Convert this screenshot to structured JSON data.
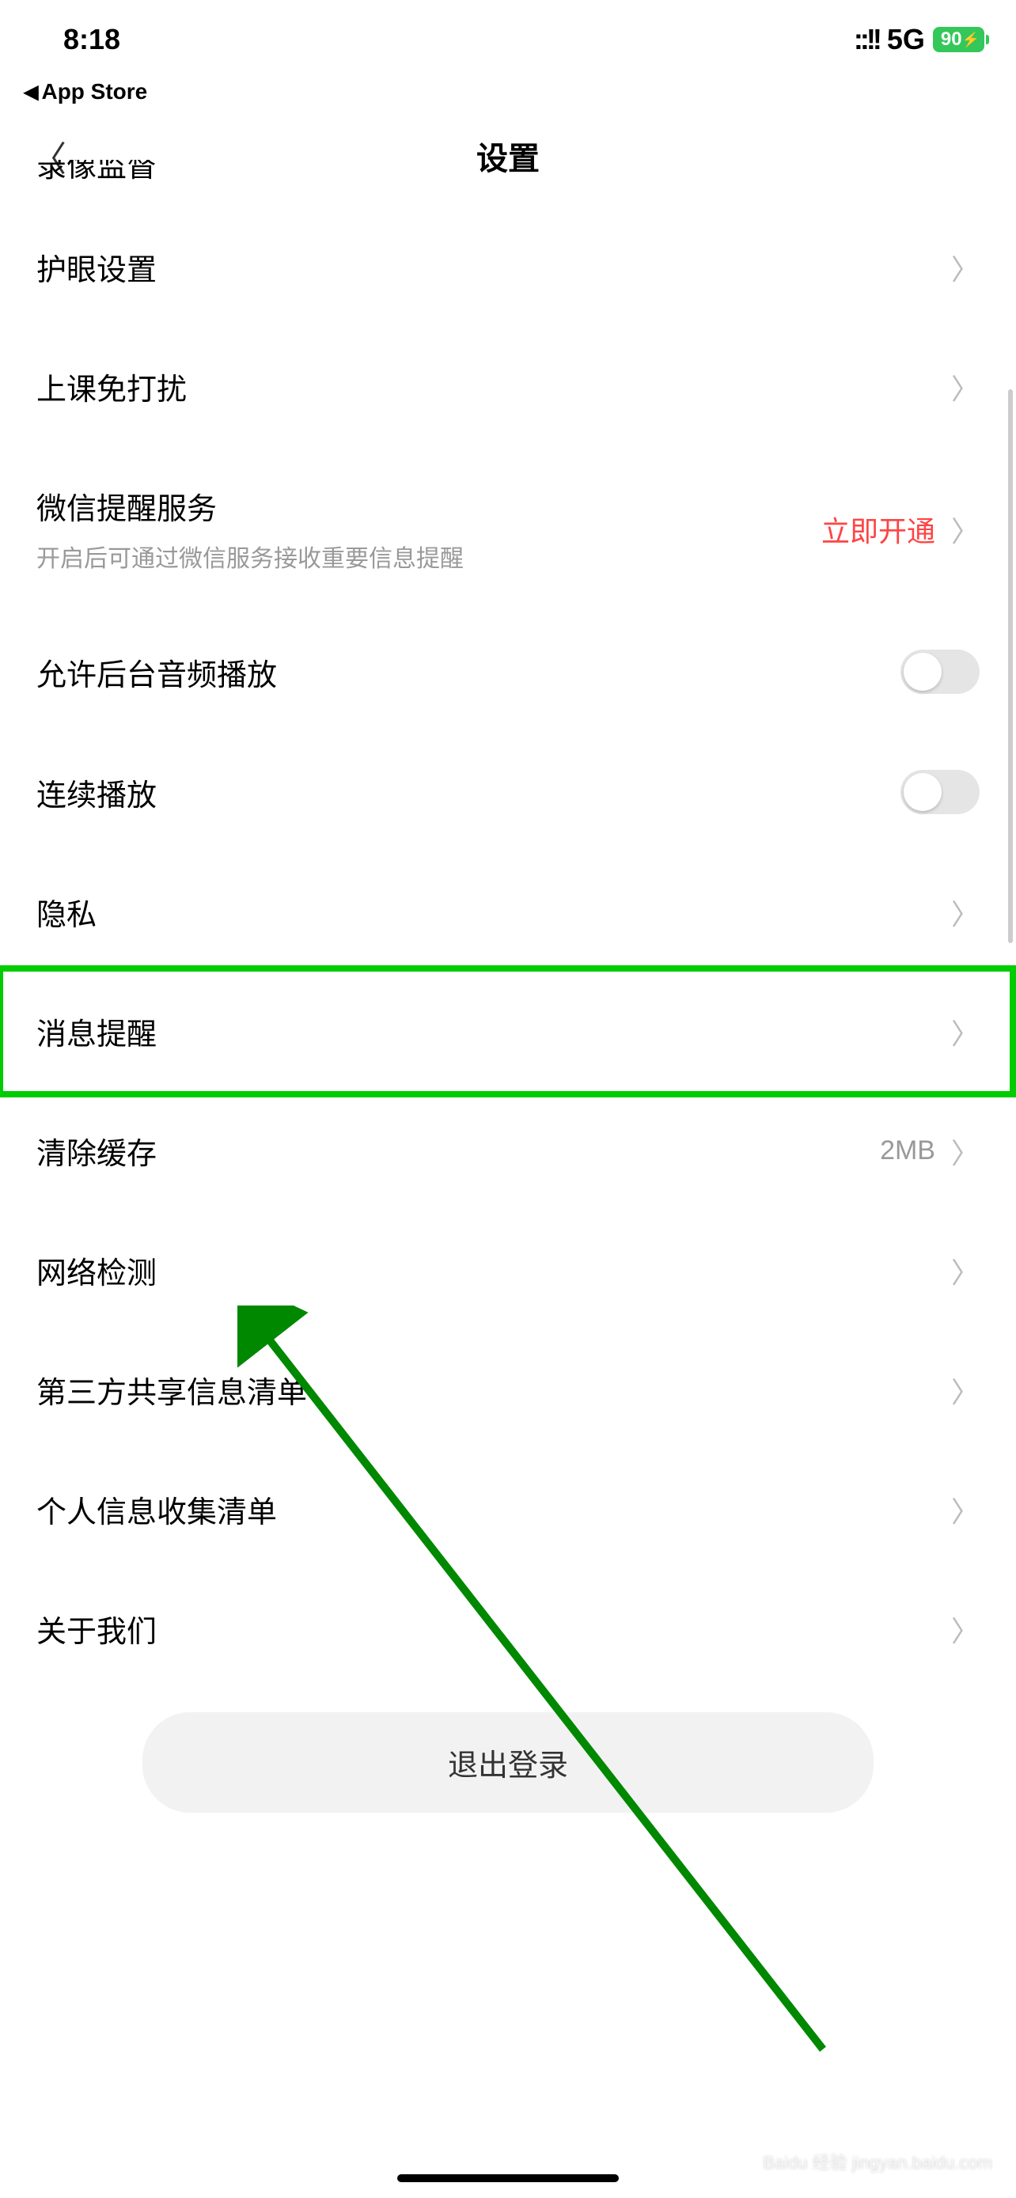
{
  "statusBar": {
    "time": "8:18",
    "signal": "::!!",
    "network": "5G",
    "battery": "90",
    "backApp": "App Store"
  },
  "nav": {
    "title": "设置"
  },
  "settings": {
    "cutOffRow": "录像监督",
    "eyeProtection": "护眼设置",
    "doNotDisturb": "上课免打扰",
    "wechatReminder": {
      "label": "微信提醒服务",
      "sublabel": "开启后可通过微信服务接收重要信息提醒",
      "action": "立即开通"
    },
    "backgroundAudio": "允许后台音频播放",
    "continuousPlay": "连续播放",
    "privacy": "隐私",
    "messageReminder": "消息提醒",
    "clearCache": {
      "label": "清除缓存",
      "value": "2MB"
    },
    "networkCheck": "网络检测",
    "thirdPartyShare": "第三方共享信息清单",
    "personalInfoCollect": "个人信息收集清单",
    "aboutUs": "关于我们",
    "logout": "退出登录"
  },
  "watermark": "Baidu 经验 jingyan.baidu.com"
}
